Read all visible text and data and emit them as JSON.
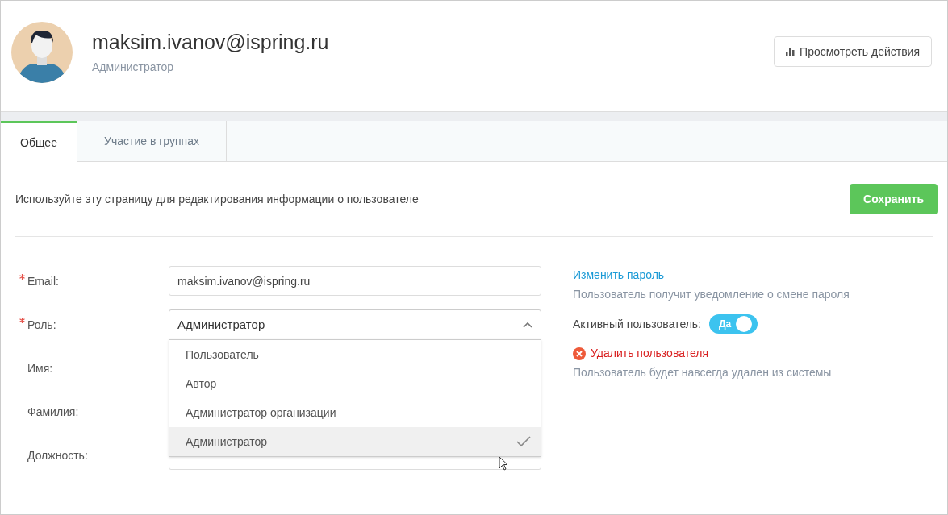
{
  "profile": {
    "name": "maksim.ivanov@ispring.ru",
    "role": "Администратор"
  },
  "actions_button": "Просмотреть действия",
  "tabs": [
    {
      "label": "Общее",
      "selected": true
    },
    {
      "label": "Участие в группах",
      "selected": false
    }
  ],
  "intro": "Используйте эту страницу для редактирования информации о пользователе",
  "save_button": "Сохранить",
  "fields": [
    {
      "label": "Email:",
      "required": true,
      "kind": "input",
      "value": "maksim.ivanov@ispring.ru"
    },
    {
      "label": "Роль:",
      "required": true,
      "kind": "select",
      "value": "Администратор",
      "expanded": true,
      "options": [
        {
          "label": "Пользователь",
          "selected": false
        },
        {
          "label": "Автор",
          "selected": false
        },
        {
          "label": "Администратор организации",
          "selected": false
        },
        {
          "label": "Администратор",
          "selected": true
        }
      ]
    },
    {
      "label": "Имя:",
      "required": false,
      "kind": "covered"
    },
    {
      "label": "Фамилия:",
      "required": false,
      "kind": "covered"
    },
    {
      "label": "Должность:",
      "required": false,
      "kind": "input"
    }
  ],
  "change_password": {
    "link": "Изменить пароль",
    "hint": "Пользователь получит уведомление о смене пароля"
  },
  "active_user": {
    "label": "Активный пользователь:",
    "toggle": "Да",
    "on": true
  },
  "delete_user": {
    "link": "Удалить пользователя",
    "hint": "Пользователь будет навсегда удален из системы"
  }
}
